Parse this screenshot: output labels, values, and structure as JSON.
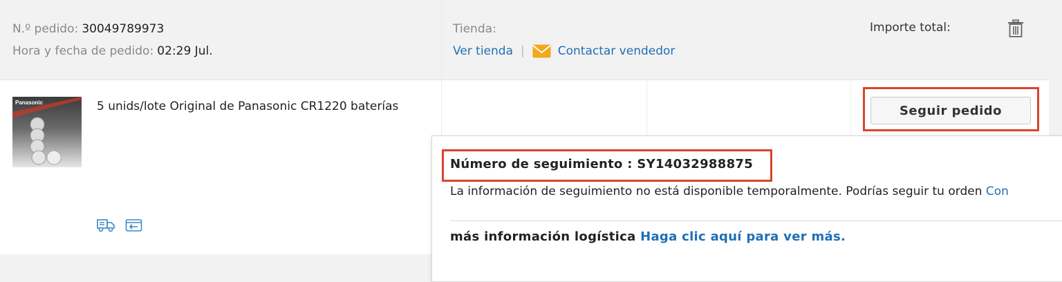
{
  "order": {
    "number_label": "N.º pedido:",
    "number_value": "30049789973",
    "date_label": "Hora y fecha de pedido:",
    "date_value": "02:29 Jul."
  },
  "store": {
    "label": "Tienda:",
    "view_link": "Ver tienda",
    "separator": "|",
    "contact_link": "Contactar vendedor"
  },
  "total": {
    "label": "Importe total:"
  },
  "product": {
    "title": "5 unids/lote Original de Panasonic CR1220 baterías",
    "image_brand": "Panasonic"
  },
  "actions": {
    "track_button": "Seguir pedido"
  },
  "tracking_popup": {
    "tracking_label": "Número de seguimiento :",
    "tracking_number": "SY14032988875",
    "info_text": "La información de seguimiento no está disponible temporalmente. Podrías seguir tu orden",
    "info_link": "Con",
    "more_label": "más información logística",
    "more_link": "Haga clic aquí para ver más."
  },
  "icons": {
    "mail": "mail-icon",
    "trash": "trash-icon",
    "shipping": "truck-icon",
    "return": "return-icon"
  },
  "colors": {
    "link": "#1f6fb5",
    "highlight_frame": "#d9432c",
    "mail_icon": "#f3a81e",
    "action_icon": "#3a86c8"
  }
}
